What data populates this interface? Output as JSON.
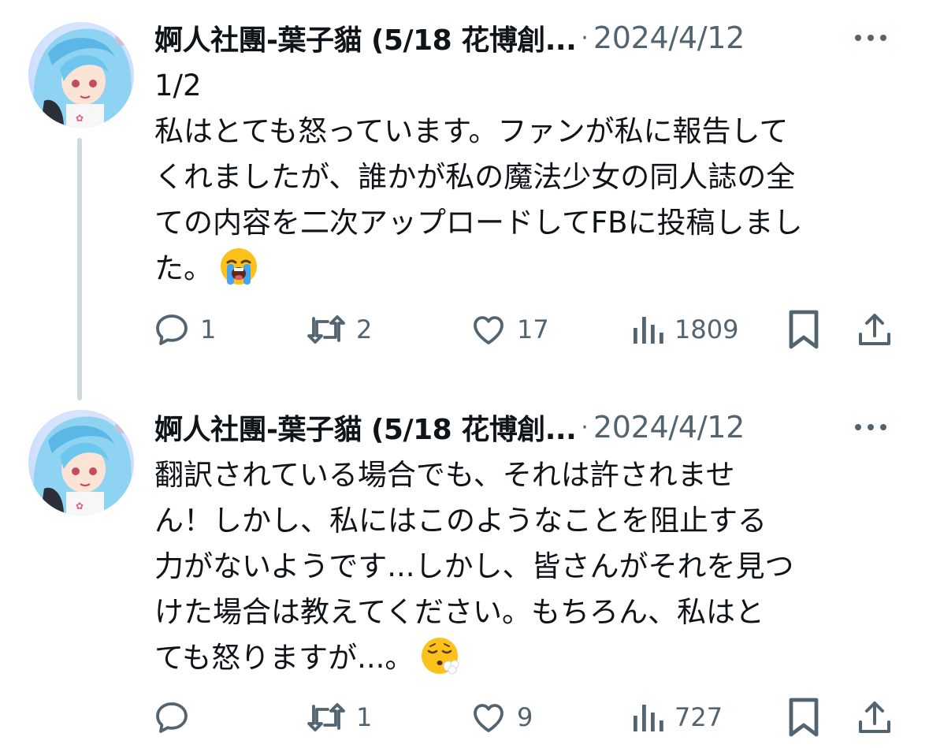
{
  "tweets": [
    {
      "author": "婀人社團-葉子貓 (5/18 花博創...",
      "separator": "·",
      "date": "2024/4/12",
      "lines": [
        "1/2",
        "私はとても怒っています。ファンが私に報告して",
        "くれましたが、誰かが私の魔法少女の同人誌の全",
        "ての内容を二次アップロードしてFBに投稿しまし",
        "た。"
      ],
      "emoji": "loudly-crying-face",
      "reply_count": "1",
      "retweet_count": "2",
      "like_count": "17",
      "view_count": "1809"
    },
    {
      "author": "婀人社團-葉子貓 (5/18 花博創...",
      "separator": "·",
      "date": "2024/4/12",
      "lines": [
        "翻訳されている場合でも、それは許されませ",
        "ん！しかし、私にはこのようなことを阻止する",
        "力がないようです...しかし、皆さんがそれを見つ",
        "けた場合は教えてください。もちろん、私はと",
        "ても怒りますが...。"
      ],
      "emoji": "face-exhaling",
      "reply_count": "",
      "retweet_count": "1",
      "like_count": "9",
      "view_count": "727"
    }
  ],
  "colors": {
    "text": "#0f1419",
    "secondary": "#536471",
    "thread_line": "#cfd9de"
  }
}
